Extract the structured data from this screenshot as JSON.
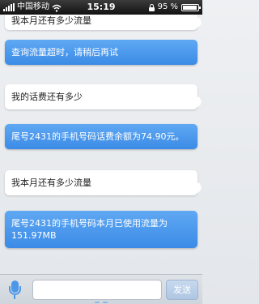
{
  "status_bar": {
    "carrier": "中国移动",
    "time": "15:19",
    "battery": "95 %",
    "battery_level": 0.95
  },
  "messages": [
    {
      "role": "user",
      "text": "我本月还有多少流量"
    },
    {
      "role": "bot",
      "text": "查询流量超时，请稍后再试"
    },
    {
      "role": "user",
      "text": "我的话费还有多少"
    },
    {
      "role": "bot",
      "text": "尾号2431的手机号码话费余额为74.90元。"
    },
    {
      "role": "user",
      "text": "我本月还有多少流量"
    },
    {
      "role": "bot",
      "text": "尾号2431的手机号码本月已使用流量为151.97MB"
    }
  ],
  "input_bar": {
    "placeholder": "",
    "send_label": "发送"
  },
  "colors": {
    "bot_bubble": "#3b8be6",
    "user_bubble": "#ffffff",
    "accent": "#4c97e8"
  }
}
